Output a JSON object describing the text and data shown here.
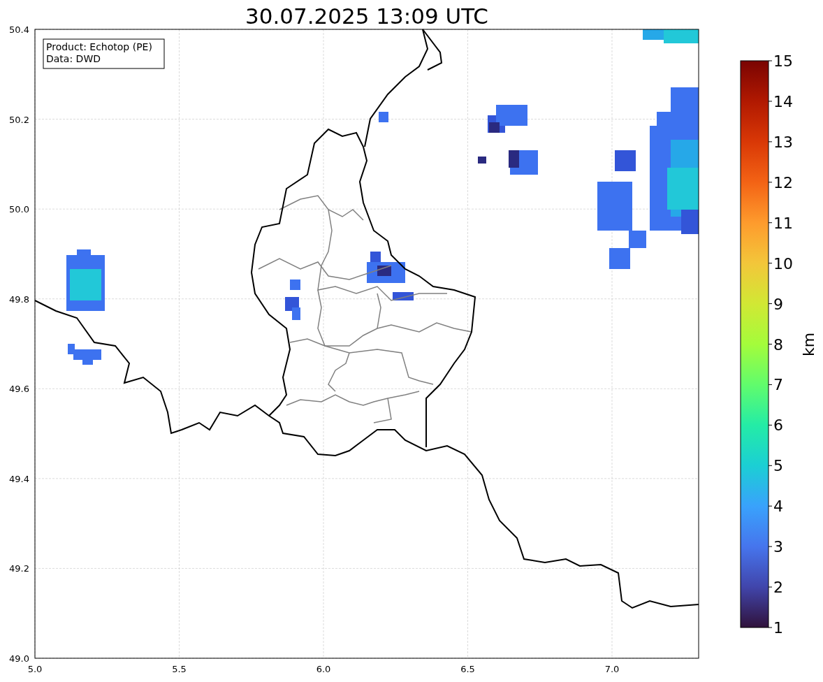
{
  "title": "30.07.2025 13:09 UTC",
  "info_box": {
    "lines": [
      "Product: Echotop (PE)",
      "Data: DWD"
    ]
  },
  "map": {
    "xticks": [
      "5.0",
      "5.5",
      "6.0",
      "6.5",
      "7.0"
    ],
    "yticks": [
      "50.4",
      "50.2",
      "50.0",
      "49.8",
      "49.6",
      "49.4",
      "49.2",
      "49.0"
    ]
  },
  "colorbar": {
    "label": "km",
    "ticks": [
      "15",
      "14",
      "13",
      "12",
      "11",
      "10",
      "9",
      "8",
      "7",
      "6",
      "5",
      "4",
      "3",
      "2",
      "1"
    ]
  }
}
